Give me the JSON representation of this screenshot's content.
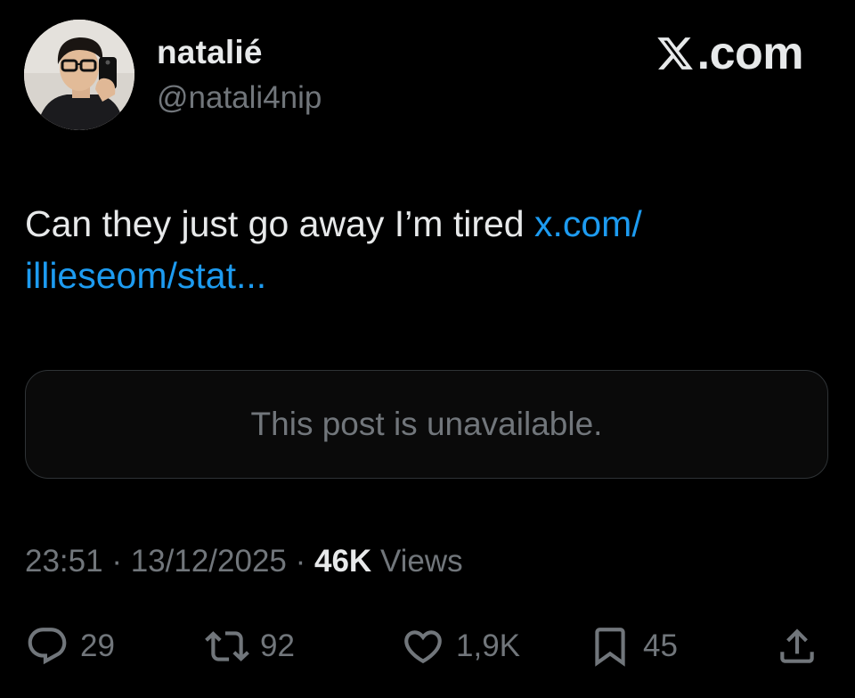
{
  "author": {
    "display_name": "natalié",
    "handle": "@natali4nip",
    "avatar_icon": "profile-photo"
  },
  "platform": {
    "logo_icon": "x-logo-icon",
    "label": ".com"
  },
  "post": {
    "text": "Can they just go away I’m tired ",
    "link_text": "x.com/\nillieseom/stat..."
  },
  "quoted_post": {
    "message": "This post is unavailable."
  },
  "meta": {
    "time": "23:51",
    "separator": " · ",
    "date": "13/12/2025",
    "views_count": "46K",
    "views_label": "Views"
  },
  "actions": {
    "reply": {
      "icon": "reply-icon",
      "count": "29"
    },
    "retweet": {
      "icon": "retweet-icon",
      "count": "92"
    },
    "like": {
      "icon": "heart-icon",
      "count": "1,9K"
    },
    "bookmark": {
      "icon": "bookmark-icon",
      "count": "45"
    },
    "share": {
      "icon": "share-icon"
    }
  },
  "colors": {
    "background": "#000000",
    "text_primary": "#e7e9ea",
    "text_secondary": "#71767b",
    "link": "#1d9bf0",
    "border": "#2f3336"
  }
}
